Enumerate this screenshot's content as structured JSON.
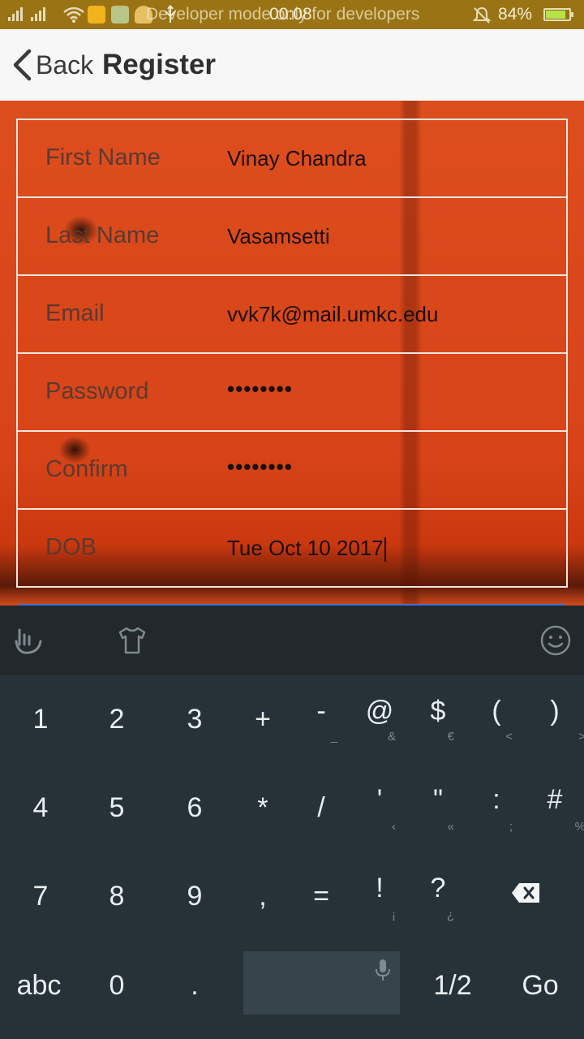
{
  "status_bar": {
    "notice": "Developer mode only for developers",
    "time": "00:08",
    "battery_percent": "84%",
    "battery_level": 0.84
  },
  "header": {
    "back_label": "Back",
    "title": "Register"
  },
  "form": {
    "fields": [
      {
        "label": "First Name",
        "value": "Vinay Chandra"
      },
      {
        "label": "Last Name",
        "value": "Vasamsetti"
      },
      {
        "label": "Email",
        "value": "vvk7k@mail.umkc.edu"
      },
      {
        "label": "Password",
        "value": "••••••••"
      },
      {
        "label": "Confirm",
        "value": "••••••••"
      },
      {
        "label": "DOB",
        "value": "Tue Oct 10 2017"
      }
    ]
  },
  "keyboard": {
    "toolbar_icons": [
      "gesture-hand-icon",
      "theme-shirt-icon",
      "emoji-icon"
    ],
    "rows": [
      [
        {
          "k": "1"
        },
        {
          "k": "2"
        },
        {
          "k": "3"
        },
        {
          "k": "+"
        },
        {
          "k": "-",
          "s": "_"
        },
        {
          "k": "@",
          "s": "&"
        },
        {
          "k": "$",
          "s": "€"
        },
        {
          "k": "(",
          "s": "<"
        },
        {
          "k": ")",
          "s": ">"
        }
      ],
      [
        {
          "k": "4"
        },
        {
          "k": "5"
        },
        {
          "k": "6"
        },
        {
          "k": "*"
        },
        {
          "k": "/"
        },
        {
          "k": "'",
          "s": "‹"
        },
        {
          "k": "\"",
          "s": "«"
        },
        {
          "k": ":",
          "s": ";"
        },
        {
          "k": "#",
          "s": "%"
        }
      ],
      [
        {
          "k": "7"
        },
        {
          "k": "8"
        },
        {
          "k": "9"
        },
        {
          "k": ","
        },
        {
          "k": "="
        },
        {
          "k": "!",
          "s": "¡"
        },
        {
          "k": "?",
          "s": "¿"
        }
      ],
      [
        {
          "k": "abc"
        },
        {
          "k": "0"
        },
        {
          "k": "."
        },
        {
          "k": "1/2"
        },
        {
          "k": "Go"
        }
      ]
    ]
  }
}
